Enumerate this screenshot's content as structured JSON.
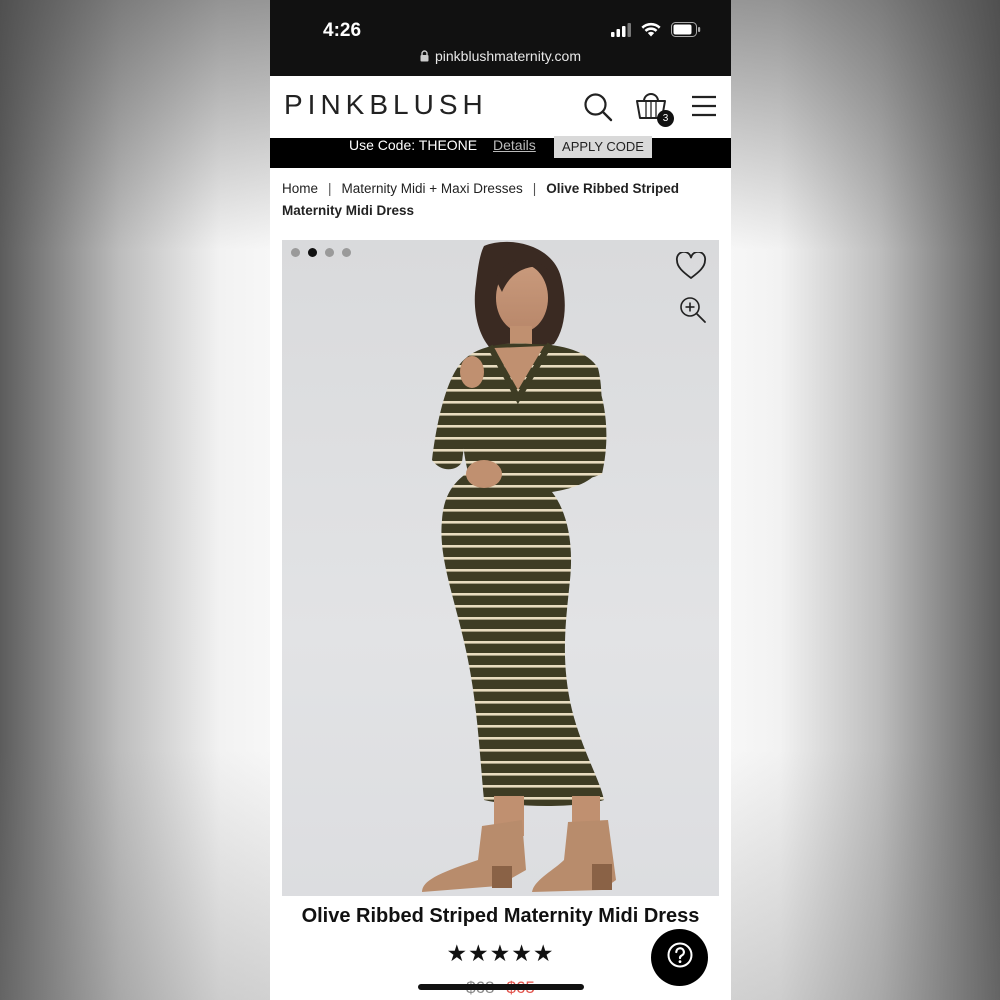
{
  "status_bar": {
    "time": "4:26",
    "url": "pinkblushmaternity.com",
    "icons": [
      "signal-icon",
      "wifi-icon",
      "battery-icon"
    ]
  },
  "header": {
    "logo": "PINKBLUSH",
    "cart_count": "3",
    "icons": [
      "search-icon",
      "cart-icon",
      "menu-icon"
    ]
  },
  "promo": {
    "code_text": "Use Code: THEONE",
    "details_label": "Details",
    "apply_label": "APPLY CODE"
  },
  "breadcrumb": {
    "items": [
      "Home",
      "Maternity Midi + Maxi Dresses"
    ],
    "current": "Olive Ribbed Striped Maternity Midi Dress"
  },
  "gallery": {
    "image_count": 4,
    "active_index": 1,
    "image_alt": "Model wearing olive ribbed striped maternity midi dress"
  },
  "product": {
    "title": "Olive Ribbed Striped Maternity Midi Dress",
    "rating_stars": "★★★★★",
    "rating": 5,
    "price_original": "$68",
    "price_sale": "$65"
  },
  "colors": {
    "dress_olive": "#3e3c24",
    "stripe_cream": "#e8dcc0",
    "sale_red": "#e2524a",
    "boot_tan": "#b88c6c"
  }
}
